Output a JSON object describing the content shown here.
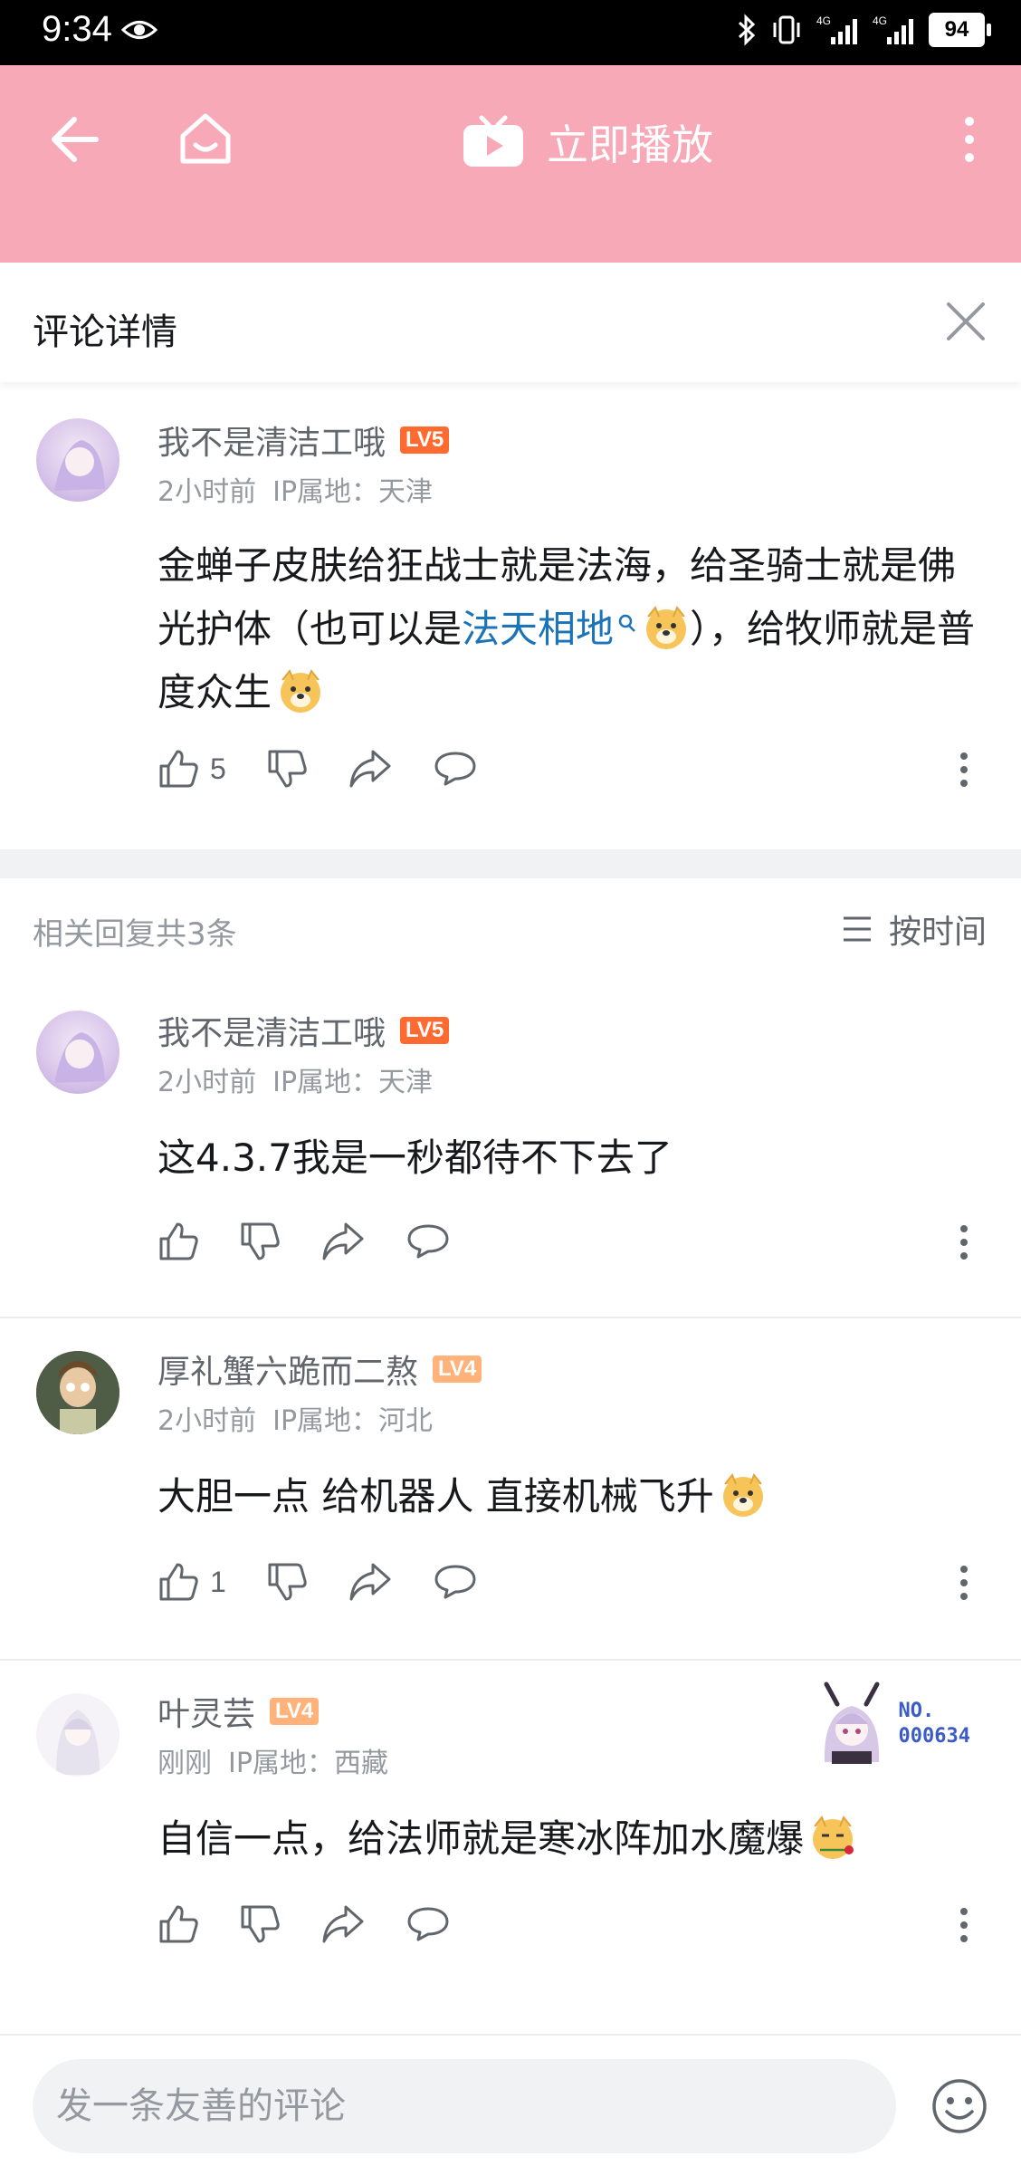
{
  "status_bar": {
    "time": "9:34",
    "signal1": "4G",
    "signal2": "4G",
    "battery": "94"
  },
  "app_bar": {
    "title": "立即播放"
  },
  "detail": {
    "title": "评论详情"
  },
  "main_comment": {
    "user": "我不是清洁工哦",
    "level": "LV5",
    "time": "2小时前",
    "ip": "IP属地：天津",
    "text_part1": "金蝉子皮肤给狂战士就是法海，给圣骑士就是佛光护体（也可以是",
    "link": "法天相地",
    "text_part2": "），给牧师就是普度众生",
    "likes": "5"
  },
  "replies_header": {
    "count": "相关回复共3条",
    "sort": "按时间"
  },
  "replies": [
    {
      "user": "我不是清洁工哦",
      "level": "LV5",
      "time": "2小时前",
      "ip": "IP属地：天津",
      "text": "这4.3.7我是一秒都待不下去了",
      "likes": ""
    },
    {
      "user": "厚礼蟹六跪而二熬",
      "level": "LV4",
      "time": "2小时前",
      "ip": "IP属地：河北",
      "text": "大胆一点 给机器人 直接机械飞升",
      "likes": "1"
    },
    {
      "user": "叶灵芸",
      "level": "LV4",
      "time": "刚刚",
      "ip": "IP属地：西藏",
      "text": "自信一点，给法师就是寒冰阵加水魔爆",
      "likes": "",
      "badge_no": "NO.",
      "badge_num": "000634"
    }
  ],
  "comment_input": {
    "placeholder": "发一条友善的评论"
  },
  "colors": {
    "header_pink": "#f8a9b8",
    "link_blue": "#1b73b8",
    "lv5": "#ff6a31",
    "lv4": "#ffb27a"
  }
}
